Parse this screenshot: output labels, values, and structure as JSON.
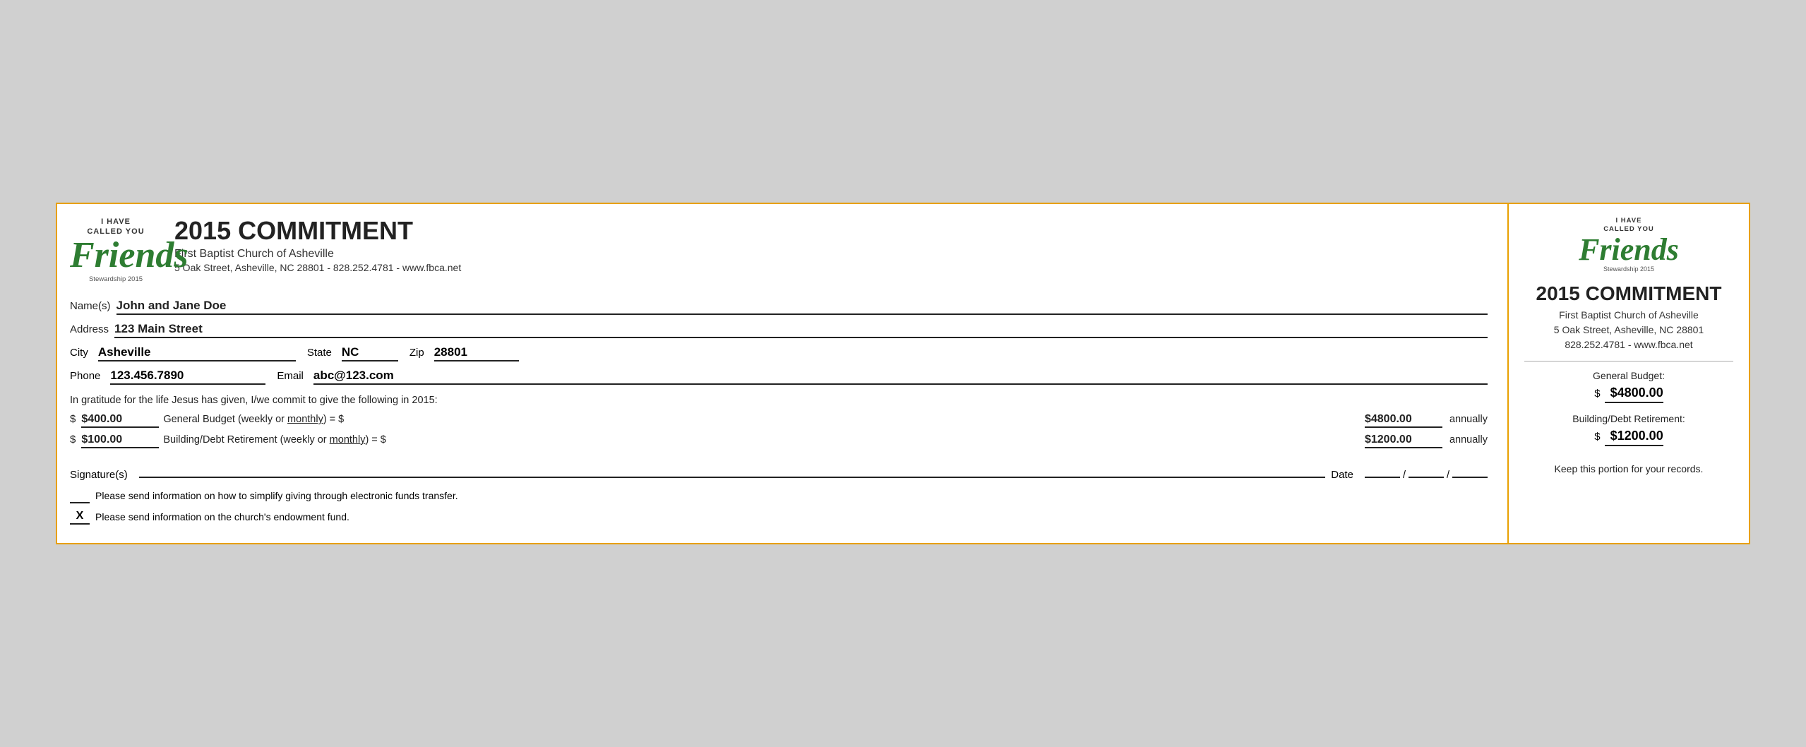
{
  "header": {
    "logo": {
      "top_line1": "I HAVE",
      "top_line2": "CALLED YOU",
      "friends": "Friends",
      "stewardship": "Stewardship 2015"
    },
    "title": "2015 COMMITMENT",
    "church_name": "First Baptist Church of Asheville",
    "address": "5 Oak Street, Asheville, NC  28801 - 828.252.4781 - www.fbca.net"
  },
  "form": {
    "name_label": "Name(s)",
    "name_value": "John and Jane Doe",
    "address_label": "Address",
    "address_value": "123 Main Street",
    "city_label": "City",
    "city_value": "Asheville",
    "state_label": "State",
    "state_value": "NC",
    "zip_label": "Zip",
    "zip_value": "28801",
    "phone_label": "Phone",
    "phone_value": "123.456.7890",
    "email_label": "Email",
    "email_value": "abc@123.com"
  },
  "commitment": {
    "intro_text": "In gratitude for the life Jesus has given, I/we commit to give the following in 2015:",
    "general_budget": {
      "weekly_amount": "$400.00",
      "description_pre": "General Budget (weekly or ",
      "description_monthly": "monthly",
      "description_post": ") = $",
      "annual_amount": "$4800.00",
      "annually": "annually"
    },
    "building_debt": {
      "weekly_amount": "$100.00",
      "description_pre": "Building/Debt Retirement (weekly or ",
      "description_monthly": "monthly",
      "description_post": ") = $",
      "annual_amount": "$1200.00",
      "annually": "annually"
    }
  },
  "signature": {
    "label": "Signature(s)",
    "date_label": "Date",
    "date_slash1": "/",
    "date_slash2": "/"
  },
  "checkboxes": {
    "eft": {
      "checked": false,
      "text": "Please send information on how to simplify giving through electronic funds transfer."
    },
    "endowment": {
      "checked": true,
      "check_mark": "X",
      "text": "Please send information on the church's endowment fund."
    }
  },
  "stub": {
    "logo": {
      "top_line1": "I HAVE",
      "top_line2": "CALLED YOU",
      "friends": "Friends",
      "stewardship": "Stewardship 2015"
    },
    "title": "2015 COMMITMENT",
    "church_name": "First Baptist Church of Asheville",
    "address_line1": "5 Oak Street, Asheville, NC  28801",
    "address_line2": "828.252.4781 - www.fbca.net",
    "general_budget_label": "General Budget:",
    "general_budget_dollar": "$",
    "general_budget_value": "$4800.00",
    "building_label": "Building/Debt Retirement:",
    "building_dollar": "$",
    "building_value": "$1200.00",
    "footer": "Keep this portion for your records."
  }
}
